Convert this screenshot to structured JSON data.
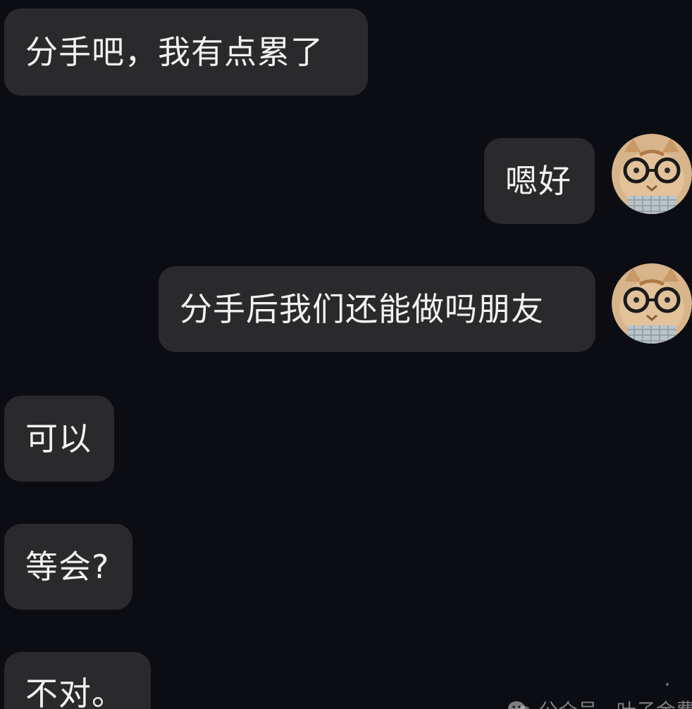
{
  "chat": {
    "messages": [
      {
        "side": "received",
        "text": "分手吧，我有点累了"
      },
      {
        "side": "sent",
        "text": "嗯好"
      },
      {
        "side": "sent",
        "text": "分手后我们还能做吗朋友"
      },
      {
        "side": "received",
        "text": "可以"
      },
      {
        "side": "received",
        "text": "等会?"
      },
      {
        "side": "received",
        "text": "不对。"
      }
    ]
  },
  "avatar": {
    "icon": "cat-with-glasses-avatar"
  },
  "watermark": {
    "icon": "wechat-icon",
    "text": "公众号 · 叶子金费"
  },
  "colors": {
    "background": "#0c0d12",
    "bubble": "#2a2a2c",
    "text": "#f2f2f2"
  }
}
